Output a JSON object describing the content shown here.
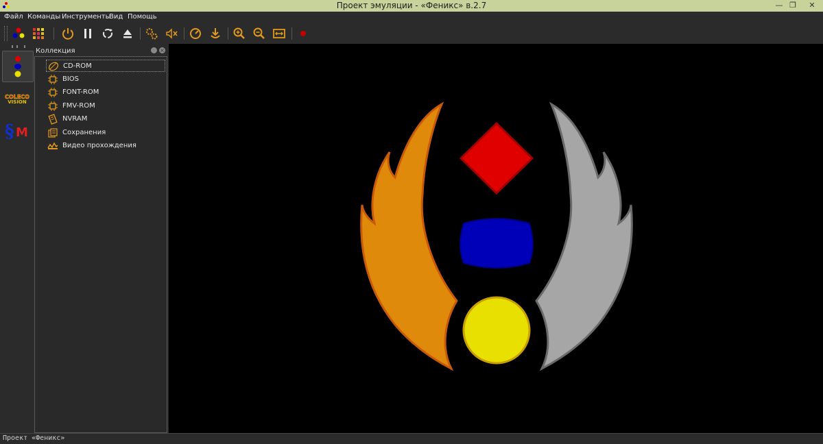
{
  "window": {
    "title": "Проект эмуляции - «Феникс» в.2.7",
    "minimize_glyph": "—",
    "restore_glyph": "❐",
    "close_glyph": "✕"
  },
  "menu": {
    "items": [
      "Файл",
      "Команды",
      "Инструменты",
      "Вид",
      "Помощь"
    ]
  },
  "toolbar": {
    "icons": [
      "systems-icon",
      "palette-grid-icon",
      "power-icon",
      "pause-icon",
      "reset-icon",
      "eject-icon",
      "settings-gears-icon",
      "mute-icon",
      "speedometer-icon",
      "save-state-icon",
      "zoom-in-icon",
      "zoom-out-icon",
      "fit-window-icon",
      "record-icon"
    ]
  },
  "systems": {
    "items": [
      "3do-logo-icon",
      "colecovision-logo-icon",
      "sega-master-logo-icon"
    ],
    "coleco_label": "COLECO VISION",
    "sm_label": "§M"
  },
  "collection": {
    "title": "Коллекция",
    "items": [
      {
        "label": "CD-ROM",
        "icon": "disc-icon"
      },
      {
        "label": "BIOS",
        "icon": "chip-icon"
      },
      {
        "label": "FONT-ROM",
        "icon": "chip-icon"
      },
      {
        "label": "FMV-ROM",
        "icon": "chip-icon"
      },
      {
        "label": "NVRAM",
        "icon": "memory-card-icon"
      },
      {
        "label": "Сохранения",
        "icon": "saves-icon"
      },
      {
        "label": "Видео прохождения",
        "icon": "video-icon"
      }
    ]
  },
  "status": {
    "text": "Проект «Феникс»"
  },
  "colors": {
    "accent": "#e39a1c",
    "titlebar": "#c7d39a",
    "logo_red": "#e00000",
    "logo_blue": "#0000b8",
    "logo_yellow": "#e8e000",
    "wing_left": "#e08a0c",
    "wing_right": "#a6a6a6"
  }
}
